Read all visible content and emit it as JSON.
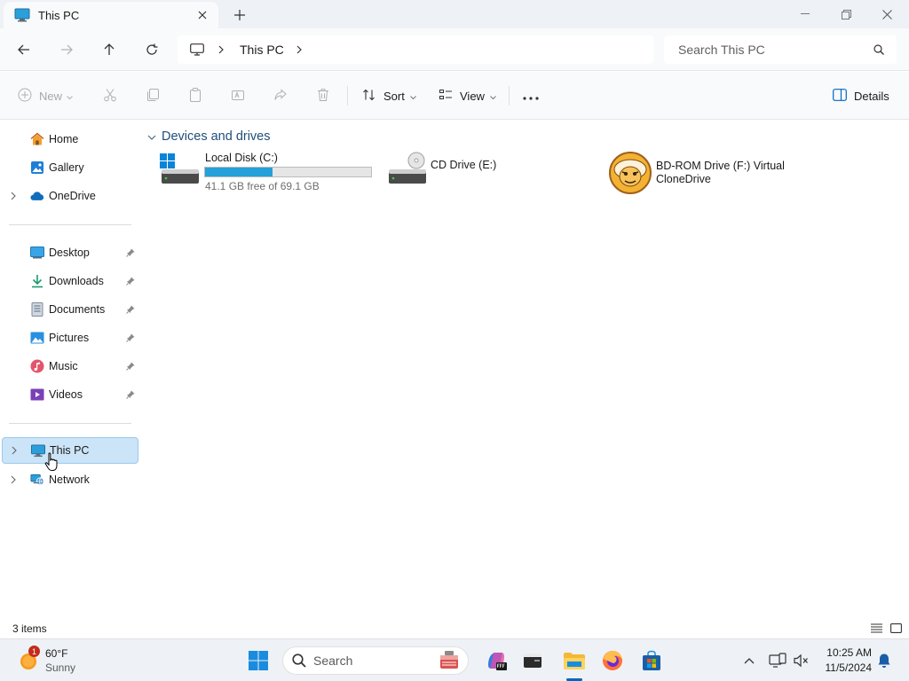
{
  "window": {
    "tab_title": "This PC",
    "new_tab_label": "+"
  },
  "navigation": {
    "breadcrumb": [
      "This PC"
    ],
    "search_placeholder": "Search This PC"
  },
  "toolbar": {
    "new_label": "New",
    "sort_label": "Sort",
    "view_label": "View",
    "more_label": "...",
    "details_label": "Details"
  },
  "sidebar": {
    "top_items": [
      {
        "label": "Home",
        "icon": "home-icon"
      },
      {
        "label": "Gallery",
        "icon": "gallery-icon"
      },
      {
        "label": "OneDrive",
        "icon": "onedrive-icon"
      }
    ],
    "pinned_items": [
      {
        "label": "Desktop",
        "icon": "desktop-icon"
      },
      {
        "label": "Downloads",
        "icon": "downloads-icon"
      },
      {
        "label": "Documents",
        "icon": "documents-icon"
      },
      {
        "label": "Pictures",
        "icon": "pictures-icon"
      },
      {
        "label": "Music",
        "icon": "music-icon"
      },
      {
        "label": "Videos",
        "icon": "videos-icon"
      }
    ],
    "bottom_items": [
      {
        "label": "This PC",
        "icon": "this-pc-icon",
        "selected": true
      },
      {
        "label": "Network",
        "icon": "network-icon"
      }
    ]
  },
  "content": {
    "group_title": "Devices and drives",
    "drives": [
      {
        "name": "Local Disk (C:)",
        "free_text": "41.1 GB free of 69.1 GB",
        "used_fraction": 0.405,
        "icon": "local-disk-icon"
      },
      {
        "name": "CD Drive (E:)",
        "icon": "cd-drive-icon"
      },
      {
        "name_line1": "BD-ROM Drive (F:) Virtual",
        "name_line2": "CloneDrive",
        "icon": "clonedrive-sheep-icon"
      }
    ]
  },
  "status": {
    "item_count": "3 items"
  },
  "taskbar": {
    "weather_badge": "1",
    "temperature": "60°F",
    "condition": "Sunny",
    "search_label": "Search",
    "time": "10:25 AM",
    "date": "11/5/2024"
  },
  "colors": {
    "accent": "#0067c0",
    "selection": "#cce4f7",
    "drive_fill": "#26a0da"
  }
}
